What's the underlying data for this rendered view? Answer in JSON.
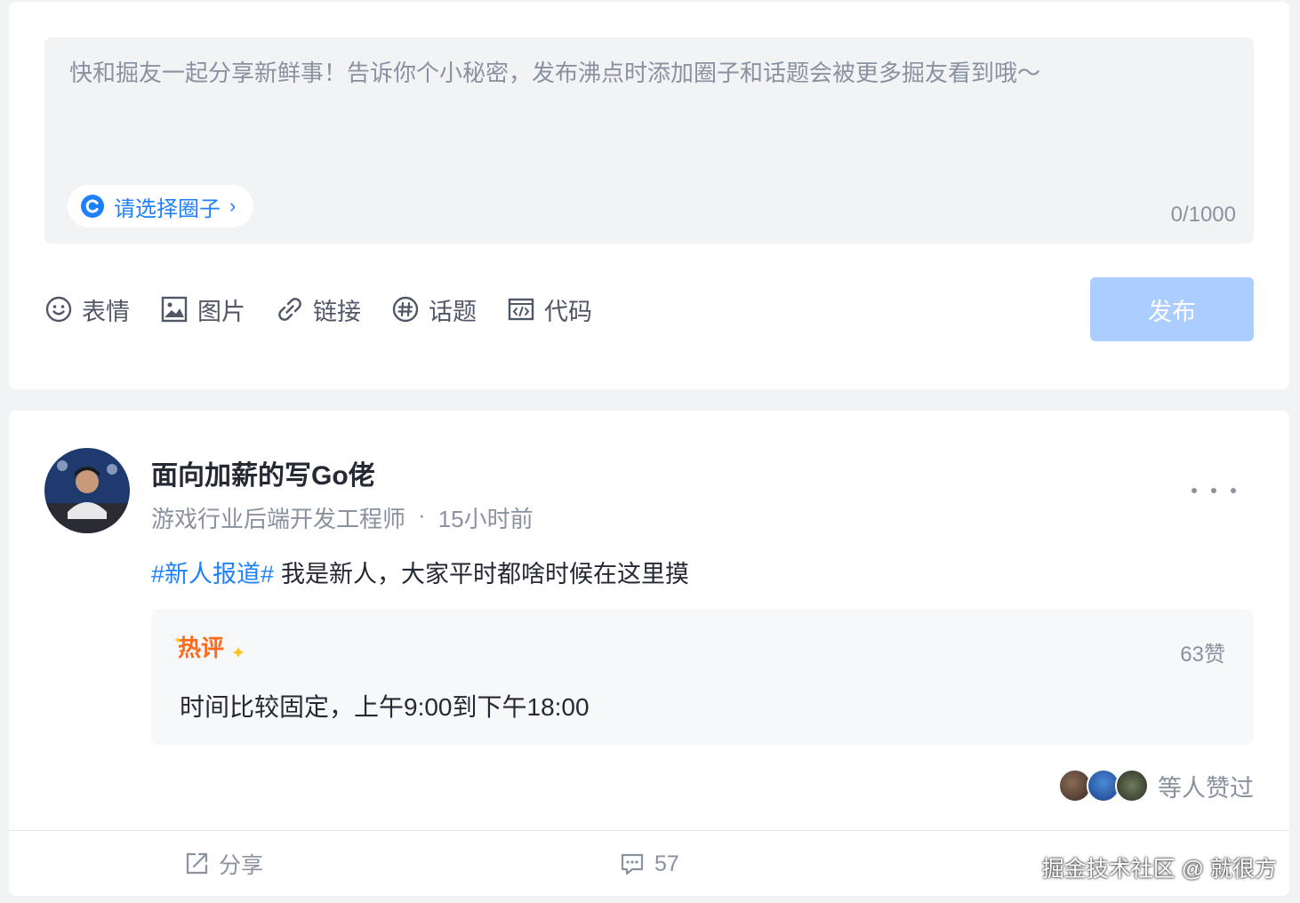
{
  "composer": {
    "placeholder": "快和掘友一起分享新鲜事！告诉你个小秘密，发布沸点时添加圈子和话题会被更多掘友看到哦～",
    "circle_label": "请选择圈子",
    "counter": "0/1000",
    "tools": {
      "emoji": "表情",
      "image": "图片",
      "link": "链接",
      "topic": "话题",
      "code": "代码"
    },
    "publish": "发布"
  },
  "post": {
    "author": "面向加薪的写Go佬",
    "job_title": "游戏行业后端开发工程师",
    "separator": "·",
    "time": "15小时前",
    "topic": "#新人报道#",
    "text": "我是新人，大家平时都啥时候在这里摸",
    "hot_comment": {
      "badge": "热评",
      "likes": "63赞",
      "text": "时间比较固定，上午9:00到下午18:00"
    },
    "likers_text": "等人赞过",
    "actions": {
      "share": "分享",
      "comments": "57"
    }
  },
  "watermark": "掘金技术社区 @ 就很方",
  "colors": {
    "accent": "#1e80ff",
    "publish_disabled": "#abcdff",
    "hot_badge": "#ff6a1a"
  }
}
